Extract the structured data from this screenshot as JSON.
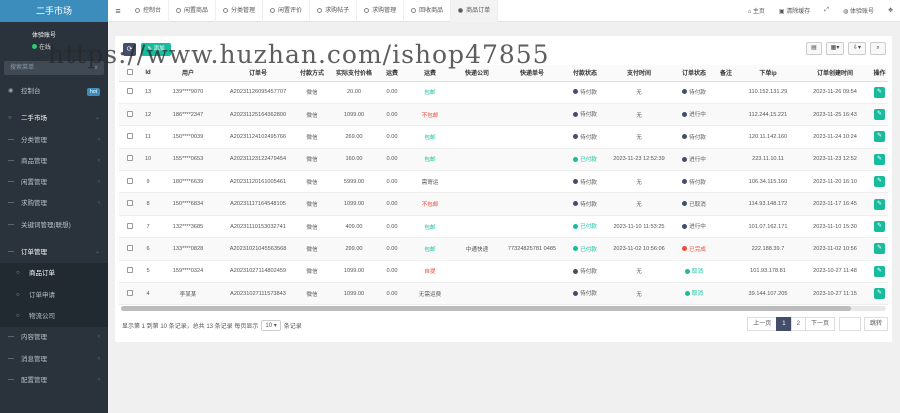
{
  "sidebar": {
    "brand": "二手市场",
    "user_name": "体验账号",
    "user_status": "在线",
    "search_placeholder": "搜索菜单",
    "items": [
      {
        "label": "控制台",
        "badge": "hot"
      },
      {
        "label": "二手市场"
      },
      {
        "label": "分类管理"
      },
      {
        "label": "商品管理"
      },
      {
        "label": "闲置管理"
      },
      {
        "label": "求购管理"
      },
      {
        "label": "关键词管理(联想)"
      },
      {
        "label": "订单管理"
      },
      {
        "label": "商品订单"
      },
      {
        "label": "订单申请"
      },
      {
        "label": "物流公司"
      },
      {
        "label": "内容管理"
      },
      {
        "label": "消息管理"
      },
      {
        "label": "配置管理"
      }
    ]
  },
  "topbar": {
    "tabs": [
      "控制台",
      "闲置商品",
      "分类管理",
      "闲置评价",
      "求购帖子",
      "求购管理",
      "回收商品",
      "商品订单"
    ],
    "right": [
      "主页",
      "清除缓存",
      "",
      "体验账号"
    ]
  },
  "toolbar": {
    "add_label": "添加"
  },
  "table": {
    "headers": [
      "",
      "Id",
      "用户",
      "订单号",
      "付款方式",
      "实际支付价格",
      "运费",
      "运费",
      "快递公司",
      "快递单号",
      "付款状态",
      "支付时间",
      "订单状态",
      "备注",
      "下单ip",
      "订单创建时间",
      "操作"
    ],
    "rows": [
      [
        "13",
        "139****9070",
        "A20231126095457707",
        "微信",
        "20.00",
        "0.00",
        "包邮",
        "",
        "",
        "待付款",
        "无",
        "待付款",
        "",
        "110.152.131.29",
        "2023-11-26 09:54"
      ],
      [
        "12",
        "186****2347",
        "A20231125164362800",
        "微信",
        "1099.00",
        "0.00",
        "不包邮",
        "",
        "",
        "待付款",
        "无",
        "进行中",
        "",
        "112.244.15.221",
        "2023-11-25 16:43"
      ],
      [
        "11",
        "150****0039",
        "A20231124102495766",
        "微信",
        "269.00",
        "0.00",
        "包邮",
        "",
        "",
        "待付款",
        "无",
        "待付款",
        "",
        "120.11.142.160",
        "2023-11-24 10:24"
      ],
      [
        "10",
        "155****0653",
        "A20231123122479454",
        "微信",
        "160.00",
        "0.00",
        "包邮",
        "",
        "",
        "已付款",
        "2023-11-23 12:52:39",
        "进行中",
        "",
        "223.11.10.11",
        "2023-11-23 12:52"
      ],
      [
        "9",
        "180****6639",
        "A20231120161005461",
        "微信",
        "5999.00",
        "0.00",
        "需寄运",
        "",
        "",
        "待付款",
        "无",
        "待付款",
        "",
        "106.34.115.160",
        "2023-11-20 16:10"
      ],
      [
        "8",
        "150****6834",
        "A20231117164548105",
        "微信",
        "1099.00",
        "0.00",
        "不包邮",
        "",
        "",
        "待付款",
        "无",
        "已取消",
        "",
        "114.93.148.172",
        "2023-11-17 16:45"
      ],
      [
        "7",
        "132****3685",
        "A20231110153032741",
        "微信",
        "409.00",
        "0.00",
        "包邮",
        "",
        "",
        "已付款",
        "2023-11-10 11:53:25",
        "进行中",
        "",
        "101.07.162.171",
        "2023-11-10 15:30"
      ],
      [
        "6",
        "133****0828",
        "A20231021045563568",
        "微信",
        "299.00",
        "0.00",
        "包邮",
        "中通快递",
        "77324825781 0485",
        "已付款",
        "2023-11-02 10:56:06",
        "已完成",
        "",
        "222.188.39.7",
        "2023-11-02 10:56"
      ],
      [
        "5",
        "159****0324",
        "A20231027114802459",
        "微信",
        "1099.00",
        "0.00",
        "自提",
        "",
        "",
        "待付款",
        "无",
        "取消",
        "",
        "101.93.178.81",
        "2023-10-27 11:48"
      ],
      [
        "4",
        "李某某",
        "A20231027111573843",
        "微信",
        "1099.00",
        "0.00",
        "无需运费",
        "",
        "",
        "待付款",
        "无",
        "取消",
        "",
        "39.144.107.205",
        "2023-10-27 11:15"
      ]
    ]
  },
  "footer": {
    "info_prefix": "显示第 1 到第 10 条记录，总共 13 条记录 每页显示",
    "page_size": "10 ▾",
    "info_suffix": "条记录",
    "prev": "上一页",
    "pages": [
      "1",
      "2"
    ],
    "next": "下一页",
    "go": "跳转"
  },
  "watermark": "https://www.huzhan.com/ishop47855"
}
